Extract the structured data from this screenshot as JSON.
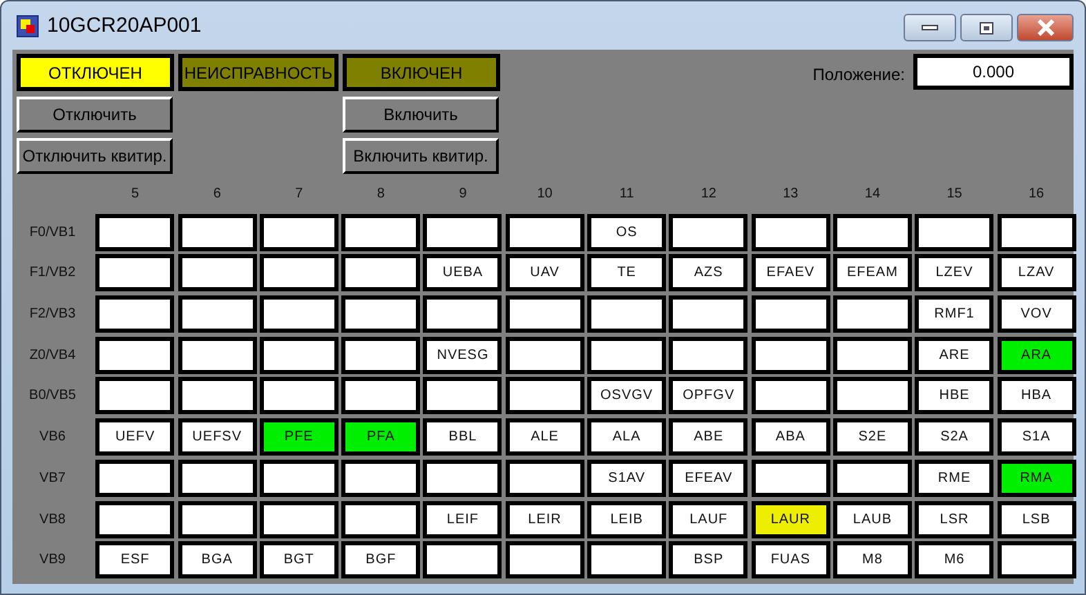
{
  "window": {
    "title": "10GCR20AP001"
  },
  "indicators": [
    {
      "label": "ОТКЛЮЧЕН",
      "on": true,
      "buttons": [
        "Отключить",
        "Отключить квитир."
      ]
    },
    {
      "label": "НЕИСПРАВНОСТЬ",
      "on": false
    },
    {
      "label": "ВКЛЮЧЕН",
      "on": false,
      "buttons": [
        "Включить",
        "Включить квитир."
      ]
    }
  ],
  "position": {
    "label": "Положение:",
    "value": "0.000"
  },
  "grid": {
    "columns": [
      "5",
      "6",
      "7",
      "8",
      "9",
      "10",
      "11",
      "12",
      "13",
      "14",
      "15",
      "16"
    ],
    "rows": [
      {
        "label": "F0/VB1",
        "cells": [
          {},
          {},
          {},
          {},
          {},
          {},
          {
            "text": "OS"
          },
          {},
          {},
          {},
          {},
          {}
        ]
      },
      {
        "label": "F1/VB2",
        "cells": [
          {},
          {},
          {},
          {},
          {
            "text": "UEBA"
          },
          {
            "text": "UAV"
          },
          {
            "text": "TE"
          },
          {
            "text": "AZS"
          },
          {
            "text": "EFAEV"
          },
          {
            "text": "EFEAM"
          },
          {
            "text": "LZEV"
          },
          {
            "text": "LZAV"
          }
        ]
      },
      {
        "label": "F2/VB3",
        "cells": [
          {},
          {},
          {},
          {},
          {},
          {},
          {},
          {},
          {},
          {},
          {
            "text": "RMF1"
          },
          {
            "text": "VOV"
          }
        ]
      },
      {
        "label": "Z0/VB4",
        "cells": [
          {},
          {},
          {},
          {},
          {
            "text": "NVESG"
          },
          {},
          {},
          {},
          {},
          {},
          {
            "text": "ARE"
          },
          {
            "text": "ARA",
            "color": "#00ee00"
          }
        ]
      },
      {
        "label": "B0/VB5",
        "cells": [
          {},
          {},
          {},
          {},
          {},
          {},
          {
            "text": "OSVGV"
          },
          {
            "text": "OPFGV"
          },
          {},
          {},
          {
            "text": "HBE"
          },
          {
            "text": "HBA"
          }
        ]
      },
      {
        "label": "VB6",
        "cells": [
          {
            "text": "UEFV"
          },
          {
            "text": "UEFSV"
          },
          {
            "text": "PFE",
            "color": "#00ee00"
          },
          {
            "text": "PFA",
            "color": "#00ee00"
          },
          {
            "text": "BBL"
          },
          {
            "text": "ALE"
          },
          {
            "text": "ALA"
          },
          {
            "text": "ABE"
          },
          {
            "text": "ABA"
          },
          {
            "text": "S2E"
          },
          {
            "text": "S2A"
          },
          {
            "text": "S1A"
          }
        ]
      },
      {
        "label": "VB7",
        "cells": [
          {},
          {},
          {},
          {},
          {},
          {},
          {
            "text": "S1AV"
          },
          {
            "text": "EFEAV"
          },
          {},
          {},
          {
            "text": "RME"
          },
          {
            "text": "RMA",
            "color": "#00ee00"
          }
        ]
      },
      {
        "label": "VB8",
        "cells": [
          {},
          {},
          {},
          {},
          {
            "text": "LEIF"
          },
          {
            "text": "LEIR"
          },
          {
            "text": "LEIB"
          },
          {
            "text": "LAUF"
          },
          {
            "text": "LAUR",
            "color": "#eeee00"
          },
          {
            "text": "LAUB"
          },
          {
            "text": "LSR"
          },
          {
            "text": "LSB"
          }
        ]
      },
      {
        "label": "VB9",
        "cells": [
          {
            "text": "ESF"
          },
          {
            "text": "BGA"
          },
          {
            "text": "BGT"
          },
          {
            "text": "BGF"
          },
          {},
          {},
          {},
          {
            "text": "BSP"
          },
          {
            "text": "FUAS"
          },
          {
            "text": "M8"
          },
          {
            "text": "M6"
          },
          {}
        ]
      }
    ]
  }
}
